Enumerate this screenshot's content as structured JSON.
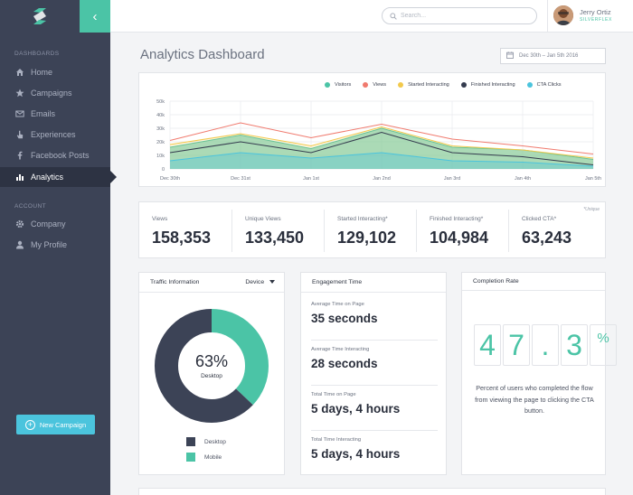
{
  "sidebar": {
    "dashboards_heading": "DASHBOARDS",
    "account_heading": "ACCOUNT",
    "collapse_icon": "‹",
    "items": [
      {
        "label": "Home",
        "icon": "home-icon"
      },
      {
        "label": "Campaigns",
        "icon": "star-icon"
      },
      {
        "label": "Emails",
        "icon": "envelope-icon"
      },
      {
        "label": "Experiences",
        "icon": "pointer-hand-icon"
      },
      {
        "label": "Facebook Posts",
        "icon": "facebook-icon"
      },
      {
        "label": "Analytics",
        "icon": "bar-chart-icon",
        "active": true
      }
    ],
    "account_items": [
      {
        "label": "Company",
        "icon": "gear-icon"
      },
      {
        "label": "My Profile",
        "icon": "user-icon"
      }
    ],
    "new_campaign_label": "New Campaign"
  },
  "topbar": {
    "search_placeholder": "Search...",
    "user_name": "Jerry Ortiz",
    "user_org": "SILVERFLEX"
  },
  "main": {
    "title": "Analytics Dashboard",
    "date_range": "Dec 30th – Jan 5th 2016"
  },
  "chart_data": {
    "type": "area",
    "categories": [
      "Dec 30th",
      "Dec 31st",
      "Jan 1st",
      "Jan 2nd",
      "Jan 3rd",
      "Jan 4th",
      "Jan 5th"
    ],
    "ylim": [
      0,
      50000
    ],
    "yticks": [
      "50k",
      "40k",
      "30k",
      "20k",
      "10k",
      "0"
    ],
    "grid": true,
    "legend_position": "top",
    "series": [
      {
        "name": "Visitors",
        "color": "#4bc4a6",
        "values": [
          16000,
          25000,
          15000,
          30000,
          16000,
          14000,
          7000
        ]
      },
      {
        "name": "Views",
        "color": "#f07a6e",
        "values": [
          21000,
          34000,
          23000,
          33000,
          22000,
          17000,
          11000
        ]
      },
      {
        "name": "Started Interacting",
        "color": "#f2c94c",
        "values": [
          18000,
          26000,
          17000,
          31000,
          17000,
          14000,
          8000
        ]
      },
      {
        "name": "Finished Interacting",
        "color": "#343b4e",
        "values": [
          12000,
          20000,
          12000,
          27000,
          12000,
          9000,
          3000
        ]
      },
      {
        "name": "CTA Clicks",
        "color": "#4bc4dd",
        "values": [
          6000,
          12000,
          8000,
          12000,
          6000,
          5000,
          2000
        ]
      }
    ]
  },
  "stats": {
    "note": "*Unique",
    "items": [
      {
        "label": "Views",
        "value": "158,353"
      },
      {
        "label": "Unique Views",
        "value": "133,450"
      },
      {
        "label": "Started Interacting*",
        "value": "129,102"
      },
      {
        "label": "Finished Interacting*",
        "value": "104,984"
      },
      {
        "label": "Clicked CTA*",
        "value": "63,243"
      }
    ]
  },
  "traffic": {
    "title": "Traffic Information",
    "device_label": "Device",
    "center_value": "63%",
    "center_label": "Desktop",
    "desktop_share": 63,
    "desktop_color": "#3c4356",
    "mobile_color": "#4bc4a6",
    "legend": [
      {
        "label": "Desktop"
      },
      {
        "label": "Mobile"
      }
    ]
  },
  "engagement": {
    "title": "Engagement Time",
    "items": [
      {
        "label": "Average Time on Page",
        "value": "35 seconds"
      },
      {
        "label": "Average Time Interacting",
        "value": "28 seconds"
      },
      {
        "label": "Total Time on Page",
        "value": "5 days, 4 hours"
      },
      {
        "label": "Total Time Interacting",
        "value": "5 days, 4 hours"
      }
    ]
  },
  "completion": {
    "title": "Completion Rate",
    "digits": [
      "4",
      "7",
      ".",
      "3",
      "%"
    ],
    "description": "Percent of users who completed the flow from viewing the page to clicking the CTA button."
  }
}
